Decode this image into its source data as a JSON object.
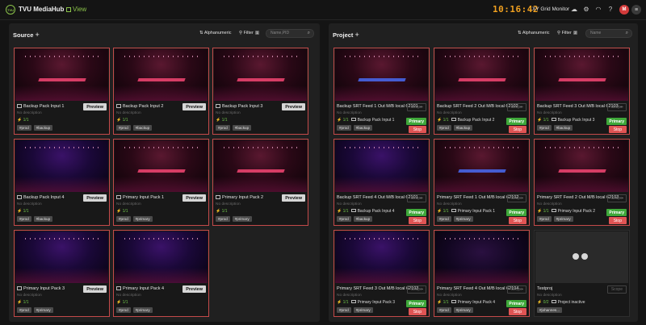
{
  "app": {
    "title": "TVU MediaHub",
    "view_label": "View",
    "clock": "10:16:42",
    "monitor_label": "XY Grid Monitor",
    "avatar_initial": "M",
    "logo_text": "TVU"
  },
  "source": {
    "title": "Source",
    "sort_label": "Alphanumeric",
    "filter_label": "Filter",
    "filter_count": "1",
    "search_placeholder": "Name,PID",
    "tiles": [
      {
        "name": "Backup Pack Input 1",
        "desc": "No description",
        "signal": "1/1",
        "tags": [
          "#prod",
          "#backup"
        ],
        "action": "Preview",
        "theme": "red"
      },
      {
        "name": "Backup Pack Input 2",
        "desc": "No description",
        "signal": "1/1",
        "tags": [
          "#prod",
          "#backup"
        ],
        "action": "Preview",
        "theme": "red"
      },
      {
        "name": "Backup Pack Input 3",
        "desc": "No description",
        "signal": "1/1",
        "tags": [
          "#prod",
          "#backup"
        ],
        "action": "Preview",
        "theme": "red"
      },
      {
        "name": "Backup Pack Input 4",
        "desc": "No description",
        "signal": "1/1",
        "tags": [
          "#prod",
          "#backup"
        ],
        "action": "Preview",
        "theme": "blue"
      },
      {
        "name": "Primary Input Pack 1",
        "desc": "No description",
        "signal": "1/1",
        "tags": [
          "#prod",
          "#primary"
        ],
        "action": "Preview",
        "theme": "red"
      },
      {
        "name": "Primary Input Pack 2",
        "desc": "No description",
        "signal": "1/1",
        "tags": [
          "#prod",
          "#primary"
        ],
        "action": "Preview",
        "theme": "red"
      },
      {
        "name": "Primary Input Pack 3",
        "desc": "No description",
        "signal": "1/1",
        "tags": [
          "#prod",
          "#primary"
        ],
        "action": "Preview",
        "theme": "blue"
      },
      {
        "name": "Primary Input Pack 4",
        "desc": "No description",
        "signal": "1/1",
        "tags": [
          "#prod",
          "#primary"
        ],
        "action": "Preview",
        "theme": "blue"
      }
    ]
  },
  "project": {
    "title": "Project",
    "sort_label": "Alphanumeric",
    "filter_label": "Filter",
    "filter_count": "2",
    "search_placeholder": "Name",
    "tiles": [
      {
        "name": "Backup SRT Feed 1 Out M/B local 62101 ...",
        "desc": "No description",
        "signal": "1/1",
        "source": "Backup Pack Input 1",
        "tags": [
          "#prod",
          "#backup"
        ],
        "scope": "Scope",
        "role": "Primary",
        "stop": "Stop",
        "theme": "red",
        "stage": "blue"
      },
      {
        "name": "Backup SRT Feed 2 Out M/B local 62102 ...",
        "desc": "No description",
        "signal": "1/1",
        "source": "Backup Pack Input 2",
        "tags": [
          "#prod",
          "#backup"
        ],
        "scope": "Scope",
        "role": "Primary",
        "stop": "Stop",
        "theme": "red",
        "stage": "red"
      },
      {
        "name": "Backup SRT Feed 3 Out M/B local 62103 ...",
        "desc": "No description",
        "signal": "1/1",
        "source": "Backup Pack Input 3",
        "tags": [
          "#prod",
          "#backup"
        ],
        "scope": "Scope",
        "role": "Primary",
        "stop": "Stop",
        "theme": "red",
        "stage": "red"
      },
      {
        "name": "Backup SRT Feed 4 Out M/B local 62101 ...",
        "desc": "No description",
        "signal": "1/1",
        "source": "Backup Pack Input 4",
        "tags": [
          "#prod",
          "#backup"
        ],
        "scope": "Scope",
        "role": "Primary",
        "stop": "Stop",
        "theme": "blue",
        "stage": "none"
      },
      {
        "name": "Primary SRT Feed 1 Out M/B local 62102 ...",
        "desc": "No description",
        "signal": "1/1",
        "source": "Primary Input Pack 1",
        "tags": [
          "#prod",
          "#primary"
        ],
        "scope": "Scope",
        "role": "Primary",
        "stop": "Stop",
        "theme": "red",
        "stage": "blue"
      },
      {
        "name": "Primary SRT Feed 2 Out M/B local 62103 ...",
        "desc": "No description",
        "signal": "1/1",
        "source": "Primary Input Pack 2",
        "tags": [
          "#prod",
          "#primary"
        ],
        "scope": "Scope",
        "role": "Primary",
        "stop": "Stop",
        "theme": "red",
        "stage": "red"
      },
      {
        "name": "Primary SRT Feed 3 Out M/B local 62103 ...",
        "desc": "No description",
        "signal": "1/1",
        "source": "Primary Input Pack 3",
        "tags": [
          "#prod",
          "#primary"
        ],
        "scope": "Scope",
        "role": "Primary",
        "stop": "Stop",
        "theme": "blue",
        "stage": "none"
      },
      {
        "name": "Primary SRT Feed 4 Out M/B local 62104 ...",
        "desc": "No description",
        "signal": "1/1",
        "source": "Primary Input Pack 4",
        "tags": [
          "#prod",
          "#primary"
        ],
        "scope": "Scope",
        "role": "Primary",
        "stop": "Stop",
        "theme": "dark",
        "stage": "none"
      },
      {
        "name": "Testproj",
        "desc": "No description",
        "signal": "0/2",
        "source": "Project inactive",
        "tags": [
          "#johannes..."
        ],
        "scope": "Scope",
        "role": "",
        "stop": "",
        "theme": "gray",
        "stage": "none"
      }
    ]
  }
}
